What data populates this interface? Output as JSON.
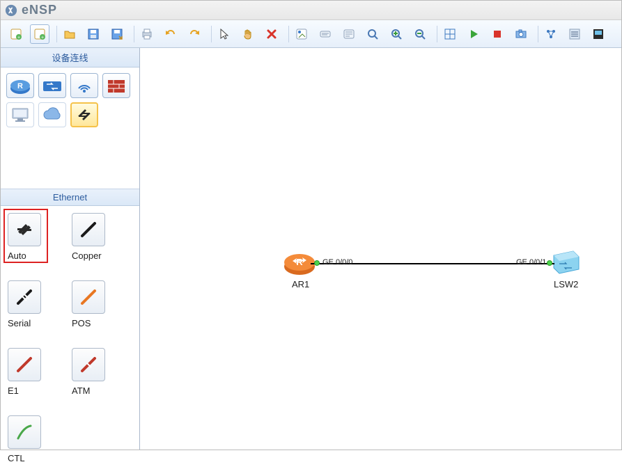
{
  "app": {
    "title": "eNSP"
  },
  "sidebar": {
    "devices_header": "设备连线",
    "cables_header": "Ethernet",
    "device_items": [
      {
        "name": "router-icon"
      },
      {
        "name": "switch-icon"
      },
      {
        "name": "wireless-icon"
      },
      {
        "name": "firewall-icon"
      },
      {
        "name": "pc-icon"
      },
      {
        "name": "cloud-icon"
      },
      {
        "name": "connection-icon"
      }
    ],
    "cable_items": [
      {
        "label": "Auto",
        "name": "auto-cable",
        "selected": true
      },
      {
        "label": "Copper",
        "name": "copper-cable"
      },
      {
        "label": "Serial",
        "name": "serial-cable"
      },
      {
        "label": "POS",
        "name": "pos-cable"
      },
      {
        "label": "E1",
        "name": "e1-cable"
      },
      {
        "label": "ATM",
        "name": "atm-cable"
      },
      {
        "label": "CTL",
        "name": "ctl-cable"
      }
    ]
  },
  "toolbar": {
    "buttons": [
      "new-topology",
      "new-topology-alt",
      "open",
      "save",
      "save-as",
      "print",
      "undo",
      "redo",
      "pointer",
      "hand",
      "delete",
      "palette",
      "text-note",
      "text-note-area",
      "zoom-fit",
      "zoom-in",
      "zoom-out",
      "grid-toggle",
      "start-devices",
      "stop-devices",
      "capture",
      "export-topology",
      "options",
      "interface-list"
    ]
  },
  "topology": {
    "nodes": [
      {
        "label": "AR1",
        "type": "router"
      },
      {
        "label": "LSW2",
        "type": "switch"
      }
    ],
    "link": {
      "if1": "GE 0/0/0",
      "if2": "GE 0/0/1"
    }
  }
}
